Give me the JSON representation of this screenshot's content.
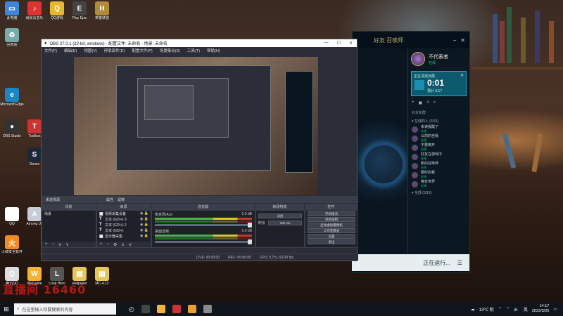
{
  "desktop": {
    "icons": [
      {
        "label": "此电脑",
        "color": "#3f86d9",
        "glyph": "▭"
      },
      {
        "label": "网易云音乐",
        "color": "#d33",
        "glyph": "♪"
      },
      {
        "label": "QQ游戏",
        "color": "#e8b930",
        "glyph": "Q"
      },
      {
        "label": "Play Epic",
        "color": "#444",
        "glyph": "E"
      },
      {
        "label": "英雄联盟",
        "color": "#b18a3c",
        "glyph": "H"
      },
      {
        "label": "回收站",
        "color": "#7aa",
        "glyph": "♻"
      },
      {
        "label": "Steam",
        "color": "#1b2838",
        "glyph": "S"
      },
      {
        "label": "Microsoft Edge",
        "color": "#1a86c8",
        "glyph": "e"
      },
      {
        "label": "OBS Studio",
        "color": "#333",
        "glyph": "●"
      },
      {
        "label": "Toolbox",
        "color": "#c33",
        "glyph": "T"
      },
      {
        "label": "QQ",
        "color": "#fff",
        "glyph": "Q"
      },
      {
        "label": "Among Us",
        "color": "#c8ccd6",
        "glyph": "A"
      },
      {
        "label": "火绒安全软件",
        "color": "#f08a24",
        "glyph": "火"
      },
      {
        "label": "WeGame",
        "color": "#f3b23a",
        "glyph": "W"
      },
      {
        "label": "腾讯QQ",
        "color": "#ddd",
        "glyph": "Q"
      },
      {
        "label": "Loop Hero",
        "color": "#555",
        "glyph": "L"
      },
      {
        "label": "wallpaper",
        "color": "#e6c75b",
        "glyph": "▤"
      },
      {
        "label": "MC-4.12",
        "color": "#e6c75b",
        "glyph": "▤"
      }
    ],
    "watermark": "直播间 16460"
  },
  "obs": {
    "title": "OBS 27.0.1 (32-bit, windows) - 配置文件: 未命名 - 场景: 未命名",
    "menu": [
      "文件(F)",
      "编辑(E)",
      "视图(V)",
      "停靠部件(D)",
      "配置文件(P)",
      "场景集合(S)",
      "工具(T)",
      "帮助(H)"
    ],
    "source_bar": [
      "未选择源",
      "属性",
      "滤镜"
    ],
    "dock_titles": [
      "场景",
      "来源",
      "混音器",
      "转场特效",
      "控件"
    ],
    "scenes": [
      "场景"
    ],
    "sources": [
      "视频采集设备",
      "文本 (GDI+) 3",
      "文本 (GDI+) 2",
      "文本 (GDI+)",
      "显示器采集"
    ],
    "mixer": [
      {
        "label": "麦克风/Aux",
        "db": "0.0 dB"
      },
      {
        "label": "桌面音频",
        "db": "0.0 dB"
      }
    ],
    "transition": {
      "type": "淡出",
      "duration_label": "时长",
      "duration": "300 ms"
    },
    "controls": [
      "开始推流",
      "开始录制",
      "启动虚拟摄像机",
      "工作室模式",
      "设置",
      "退出"
    ],
    "status": {
      "live": "LIVE: 00:00:00",
      "rec": "REC: 00:00:00",
      "cpu": "CPU: 0.7%, 60.00 fps",
      "drops": "丢帧 (0 帧, 0.0%)"
    }
  },
  "client": {
    "header": "好友 召唤师",
    "profile_name": "不代表者",
    "profile_status": "在线",
    "queue_label": "正在寻找对局",
    "queue_timer": "0:01",
    "queue_est": "预计 3:17",
    "friends_title": "好友和群",
    "group_online": "▾ 在线的人 (4/31)",
    "group_all": "▾ 全部 (5/19)",
    "friends": [
      {
        "name": "未读提醒了",
        "status": "在线"
      },
      {
        "name": "以前的自我",
        "status": "在线"
      },
      {
        "name": "不要离开",
        "status": "在线"
      },
      {
        "name": "好友在游戏中",
        "status": "在线"
      },
      {
        "name": "新的召唤师",
        "status": "在线"
      },
      {
        "name": "那时的我",
        "status": "在线"
      },
      {
        "name": "晚安世界",
        "status": "在线"
      }
    ],
    "running": "正在运行...",
    "top_btn": "卸载"
  },
  "taskbar": {
    "search_placeholder": "在这里输入你要搜索的内容",
    "weather": "13°C 阴",
    "time": "14:17",
    "date": "2022/3/26",
    "lang": "英",
    "apps": [
      "#444",
      "#f3b23a",
      "#c33",
      "#e8a030",
      "#8a8a8a"
    ]
  }
}
